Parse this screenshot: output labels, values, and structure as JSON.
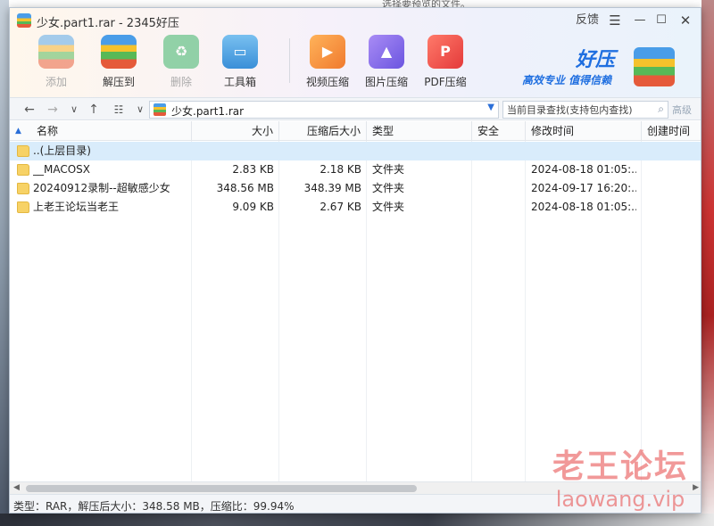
{
  "background": {
    "hint": "选择要预览的文件。"
  },
  "window": {
    "title": "少女.part1.rar - 2345好压",
    "feedback": "反馈",
    "menu_icon": "hamburger-icon",
    "min_icon": "minimize-icon",
    "max_icon": "maximize-icon",
    "close_icon": "close-icon"
  },
  "toolbar": {
    "add": "添加",
    "extract": "解压到",
    "delete": "删除",
    "tools": "工具箱",
    "video": "视频压缩",
    "image": "图片压缩",
    "pdf": "PDF压缩"
  },
  "brand": {
    "name": "好压",
    "slogan": "高效专业 值得信赖"
  },
  "address": {
    "path": "少女.part1.rar",
    "search_placeholder": "当前目录查找(支持包内查找)",
    "advanced": "高级"
  },
  "columns": {
    "name": "名称",
    "size": "大小",
    "packed": "压缩后大小",
    "type": "类型",
    "security": "安全",
    "mtime": "修改时间",
    "ctime": "创建时间"
  },
  "rows": [
    {
      "name": "..(上层目录)",
      "size": "",
      "packed": "",
      "type": "",
      "mtime": ""
    },
    {
      "name": "__MACOSX",
      "size": "2.83 KB",
      "packed": "2.18 KB",
      "type": "文件夹",
      "mtime": "2024-08-18 01:05:..."
    },
    {
      "name": "20240912录制--超敏感少女",
      "size": "348.56 MB",
      "packed": "348.39 MB",
      "type": "文件夹",
      "mtime": "2024-09-17 16:20:..."
    },
    {
      "name": "上老王论坛当老王",
      "size": "9.09 KB",
      "packed": "2.67 KB",
      "type": "文件夹",
      "mtime": "2024-08-18 01:05:..."
    }
  ],
  "status": {
    "text": "类型：RAR，解压后大小：348.58 MB，压缩比：99.94%"
  },
  "watermark": {
    "cn": "老王论坛",
    "en": "laowang.vip"
  },
  "colors": {
    "accent": "#1f6fe0",
    "selected_row": "#d9ecfb",
    "folder": "#f7d266",
    "watermark": "#e64646"
  }
}
